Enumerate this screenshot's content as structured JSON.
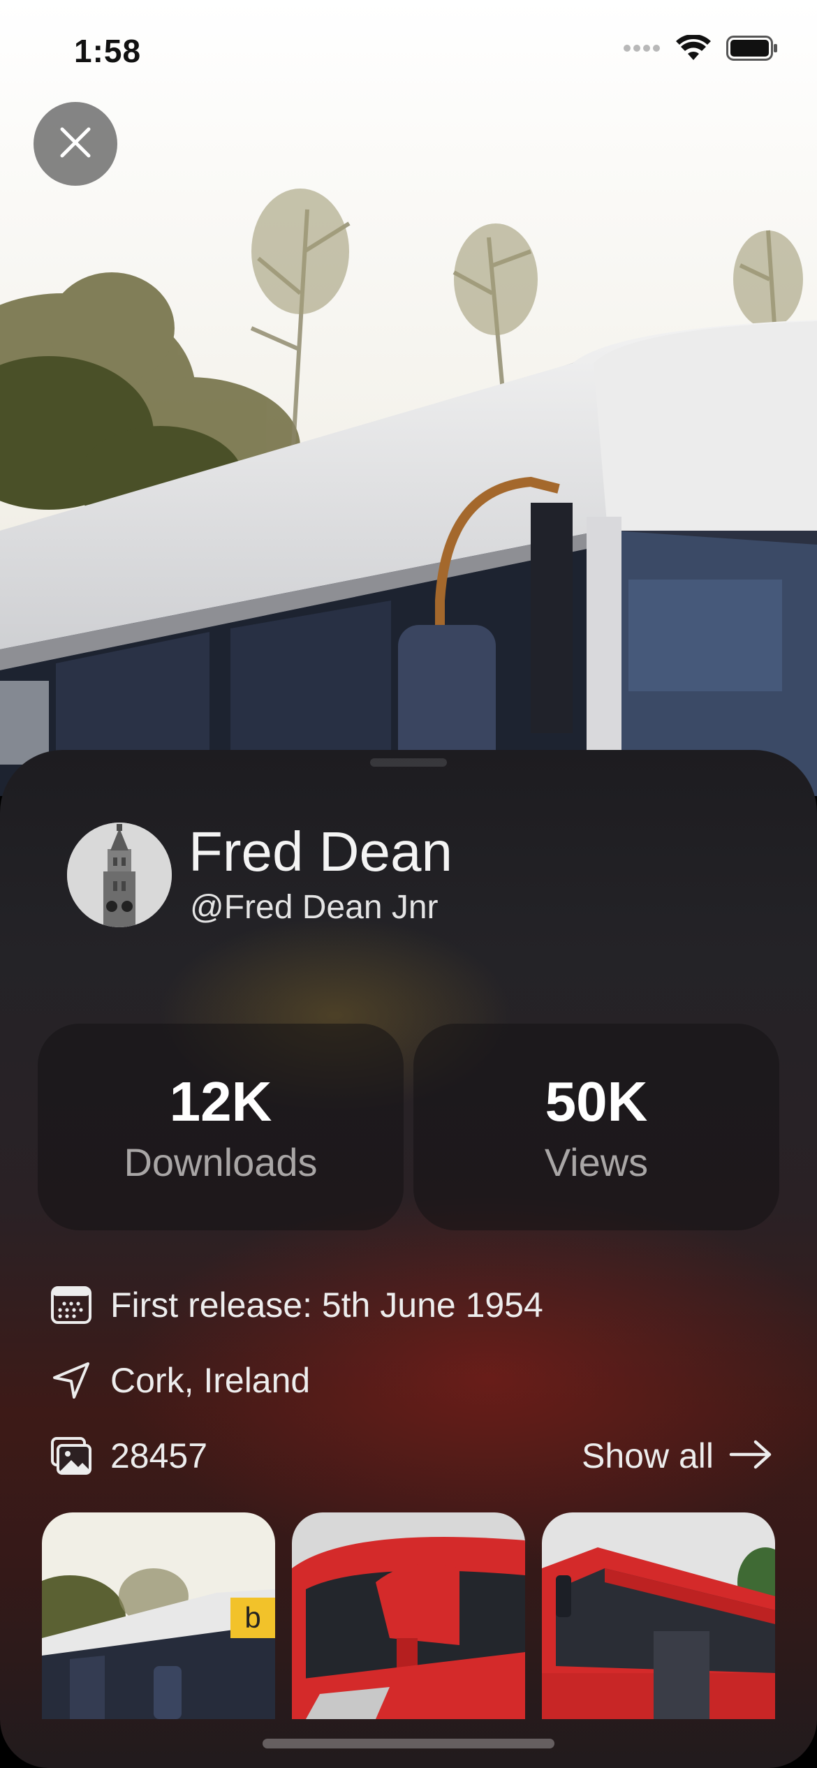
{
  "status_bar": {
    "time": "1:58",
    "icons": [
      "signal-icon",
      "wifi-icon",
      "battery-icon"
    ]
  },
  "close_icon": "close-icon",
  "profile": {
    "name": "Fred Dean",
    "handle": "@Fred Dean Jnr",
    "avatar_icon": "clock-tower-avatar"
  },
  "stats": {
    "downloads": {
      "value": "12K",
      "label": "Downloads"
    },
    "views": {
      "value": "50K",
      "label": "Views"
    }
  },
  "info": {
    "release": {
      "icon": "calendar-icon",
      "text": "First release: 5th June 1954"
    },
    "location": {
      "icon": "location-arrow-icon",
      "text": "Cork, Ireland"
    },
    "photos": {
      "icon": "photos-icon",
      "text": "28457"
    }
  },
  "show_all": {
    "label": "Show all",
    "icon": "arrow-right-icon"
  },
  "thumbnails": [
    "white-bus-photo",
    "red-bus-front-photo",
    "red-bus-side-photo"
  ],
  "colors": {
    "sheet_top": "#1d1c20",
    "sheet_mid": "#3d1a17",
    "text_primary": "#f4f4f4",
    "text_secondary": "#a9a6a6",
    "bus_red": "#d42a2a"
  }
}
